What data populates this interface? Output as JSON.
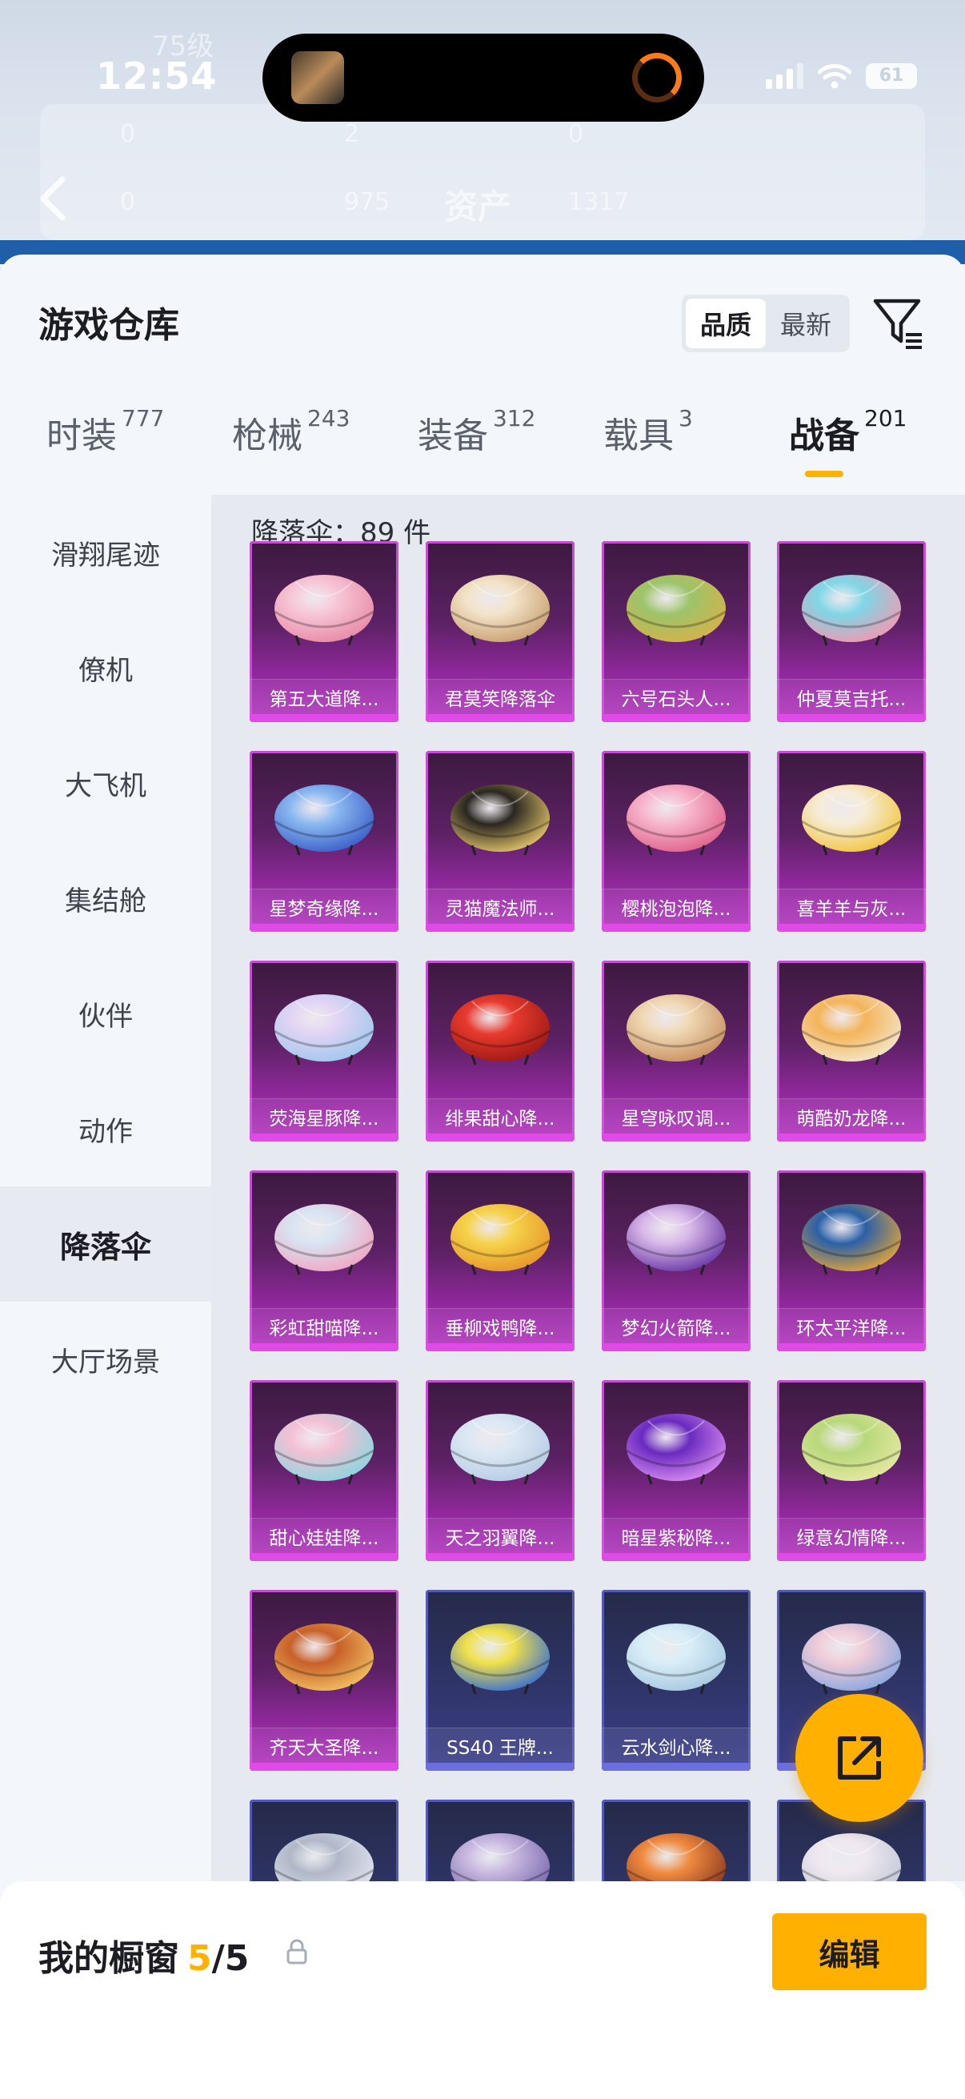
{
  "status_bar": {
    "time": "12:54",
    "battery": "61"
  },
  "header_bg": {
    "level": "75级",
    "title": "资产",
    "values": [
      "0",
      "2",
      "0",
      "0",
      "975",
      "1317"
    ]
  },
  "sheet": {
    "title": "游戏仓库",
    "sort_options": [
      "品质",
      "最新"
    ],
    "selected_sort": "品质"
  },
  "category_tabs": [
    {
      "label": "时装",
      "count": "777"
    },
    {
      "label": "枪械",
      "count": "243"
    },
    {
      "label": "装备",
      "count": "312"
    },
    {
      "label": "载具",
      "count": "3"
    },
    {
      "label": "战备",
      "count": "201",
      "active": true
    }
  ],
  "sidebar": {
    "items": [
      "滑翔尾迹",
      "僚机",
      "大飞机",
      "集结舱",
      "伙伴",
      "动作",
      "降落伞",
      "大厅场景"
    ],
    "active": "降落伞"
  },
  "grid": {
    "count_label": "降落伞：89 件",
    "items": [
      {
        "name": "第五大道降...",
        "rarity": "legendary"
      },
      {
        "name": "君莫笑降落伞",
        "rarity": "legendary"
      },
      {
        "name": "六号石头人...",
        "rarity": "legendary"
      },
      {
        "name": "仲夏莫吉托...",
        "rarity": "legendary"
      },
      {
        "name": "星梦奇缘降...",
        "rarity": "legendary"
      },
      {
        "name": "灵猫魔法师...",
        "rarity": "legendary"
      },
      {
        "name": "樱桃泡泡降...",
        "rarity": "legendary"
      },
      {
        "name": "喜羊羊与灰...",
        "rarity": "legendary"
      },
      {
        "name": "荧海星豚降...",
        "rarity": "legendary"
      },
      {
        "name": "绯果甜心降...",
        "rarity": "legendary"
      },
      {
        "name": "星穹咏叹调...",
        "rarity": "legendary"
      },
      {
        "name": "萌酷奶龙降...",
        "rarity": "legendary"
      },
      {
        "name": "彩虹甜喵降...",
        "rarity": "legendary"
      },
      {
        "name": "垂柳戏鸭降...",
        "rarity": "legendary"
      },
      {
        "name": "梦幻火箭降...",
        "rarity": "legendary"
      },
      {
        "name": "环太平洋降...",
        "rarity": "legendary"
      },
      {
        "name": "甜心娃娃降...",
        "rarity": "legendary"
      },
      {
        "name": "天之羽翼降...",
        "rarity": "legendary"
      },
      {
        "name": "暗星紫秘降...",
        "rarity": "legendary"
      },
      {
        "name": "绿意幻情降...",
        "rarity": "legendary"
      },
      {
        "name": "齐天大圣降...",
        "rarity": "legendary"
      },
      {
        "name": "SS40 王牌...",
        "rarity": "epic"
      },
      {
        "name": "云水剑心降...",
        "rarity": "epic"
      },
      {
        "name": "",
        "rarity": "epic"
      },
      {
        "name": "",
        "rarity": "epic"
      },
      {
        "name": "",
        "rarity": "epic"
      },
      {
        "name": "",
        "rarity": "epic"
      },
      {
        "name": "",
        "rarity": "epic"
      }
    ]
  },
  "bottom_bar": {
    "title": "我的橱窗",
    "current": "5",
    "total": "5",
    "edit_label": "编辑"
  },
  "colors": {
    "accent": "#ffb000",
    "legendary_card": "#9b2aa8",
    "epic_card": "#3d3f8c"
  }
}
